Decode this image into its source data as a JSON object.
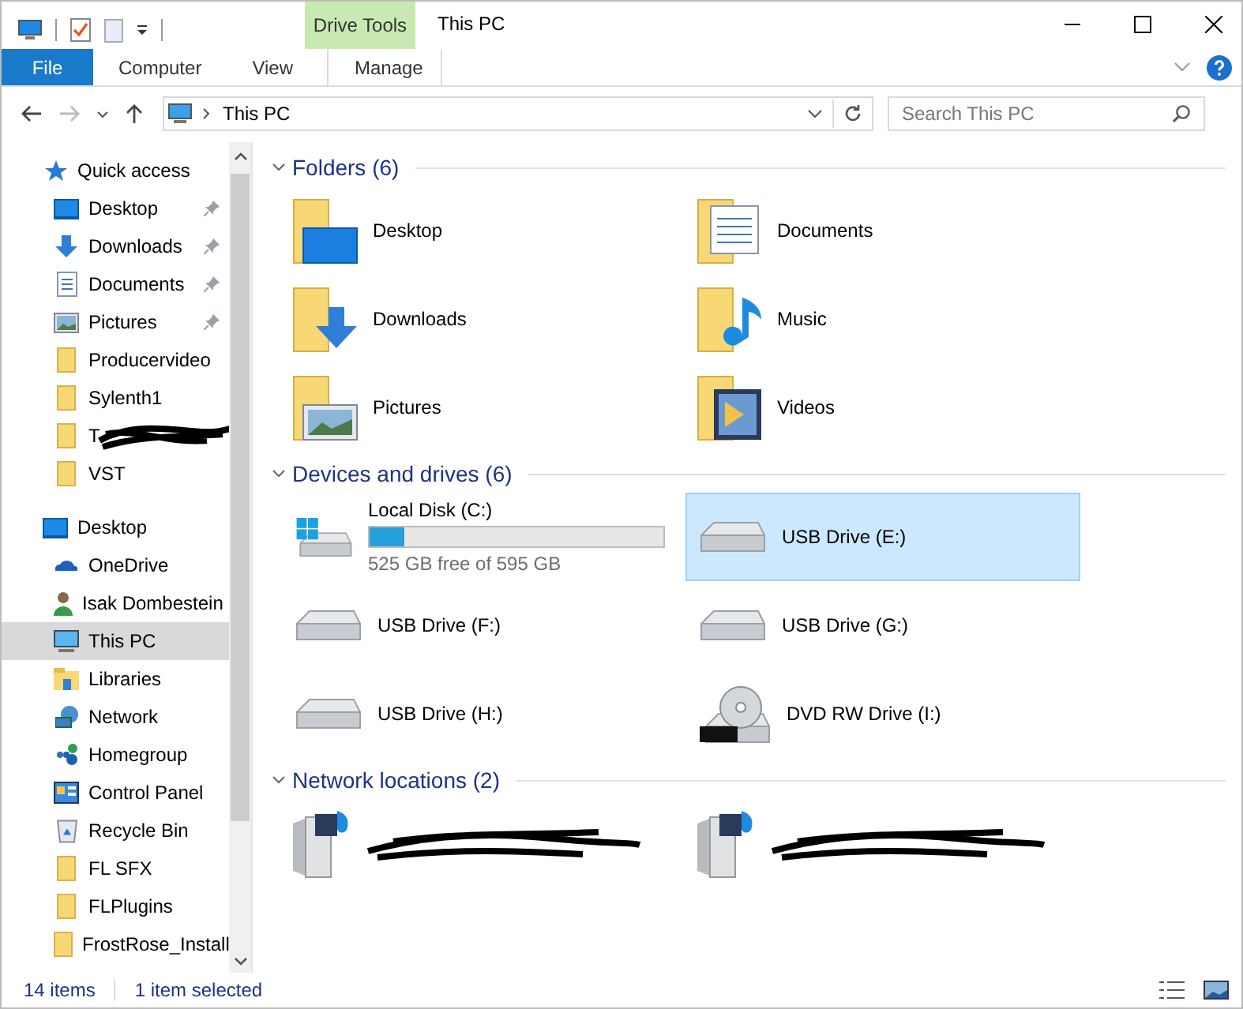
{
  "window": {
    "title": "This PC",
    "contextual_tab": "Drive Tools"
  },
  "ribbon_tabs": [
    {
      "label": "File",
      "kind": "file",
      "selected": false
    },
    {
      "label": "Computer",
      "kind": "tab",
      "selected": false
    },
    {
      "label": "View",
      "kind": "tab",
      "selected": false
    },
    {
      "label": "Manage",
      "kind": "context",
      "selected": false
    }
  ],
  "address_bar": {
    "path": "This PC"
  },
  "search": {
    "placeholder": "Search This PC"
  },
  "sidebar": {
    "items": [
      {
        "label": "Quick access",
        "pinned": false,
        "selected": false
      },
      {
        "label": "Desktop",
        "pinned": true,
        "selected": false
      },
      {
        "label": "Downloads",
        "pinned": true,
        "selected": false
      },
      {
        "label": "Documents",
        "pinned": true,
        "selected": false
      },
      {
        "label": "Pictures",
        "pinned": true,
        "selected": false
      },
      {
        "label": "Producervideo",
        "pinned": false,
        "selected": false
      },
      {
        "label": "Sylenth1",
        "pinned": false,
        "selected": false
      },
      {
        "label": "T",
        "pinned": false,
        "selected": false,
        "redacted": true
      },
      {
        "label": "VST",
        "pinned": false,
        "selected": false
      },
      {
        "label": "Desktop",
        "pinned": false,
        "selected": false
      },
      {
        "label": "OneDrive",
        "pinned": false,
        "selected": false
      },
      {
        "label": "Isak Dombestein",
        "pinned": false,
        "selected": false
      },
      {
        "label": "This PC",
        "pinned": false,
        "selected": true
      },
      {
        "label": "Libraries",
        "pinned": false,
        "selected": false
      },
      {
        "label": "Network",
        "pinned": false,
        "selected": false
      },
      {
        "label": "Homegroup",
        "pinned": false,
        "selected": false
      },
      {
        "label": "Control Panel",
        "pinned": false,
        "selected": false
      },
      {
        "label": "Recycle Bin",
        "pinned": false,
        "selected": false
      },
      {
        "label": "FL SFX",
        "pinned": false,
        "selected": false
      },
      {
        "label": "FLPlugins",
        "pinned": false,
        "selected": false
      },
      {
        "label": "FrostRose_Install",
        "pinned": false,
        "selected": false
      }
    ]
  },
  "sections": [
    {
      "title": "Folders (6)",
      "kind": "folders",
      "items": [
        {
          "name": "Desktop"
        },
        {
          "name": "Documents"
        },
        {
          "name": "Downloads"
        },
        {
          "name": "Music"
        },
        {
          "name": "Pictures"
        },
        {
          "name": "Videos"
        }
      ]
    },
    {
      "title": "Devices and drives (6)",
      "kind": "drives",
      "items": [
        {
          "name": "Local Disk (C:)",
          "kind": "system",
          "level": 0.118,
          "free": "525 GB free of 595 GB",
          "selected": false
        },
        {
          "name": "USB Drive (E:)",
          "kind": "removable",
          "selected": true
        },
        {
          "name": "USB Drive (F:)",
          "kind": "removable",
          "selected": false
        },
        {
          "name": "USB Drive (G:)",
          "kind": "removable",
          "selected": false
        },
        {
          "name": "USB Drive (H:)",
          "kind": "removable",
          "selected": false
        },
        {
          "name": "DVD RW Drive (I:)",
          "kind": "optical",
          "selected": false
        }
      ]
    },
    {
      "title": "Network locations (2)",
      "kind": "network",
      "items": [
        {
          "redacted": true
        },
        {
          "redacted": true
        }
      ]
    }
  ],
  "status_bar": {
    "count": "14 items",
    "selection": "1 item selected"
  }
}
